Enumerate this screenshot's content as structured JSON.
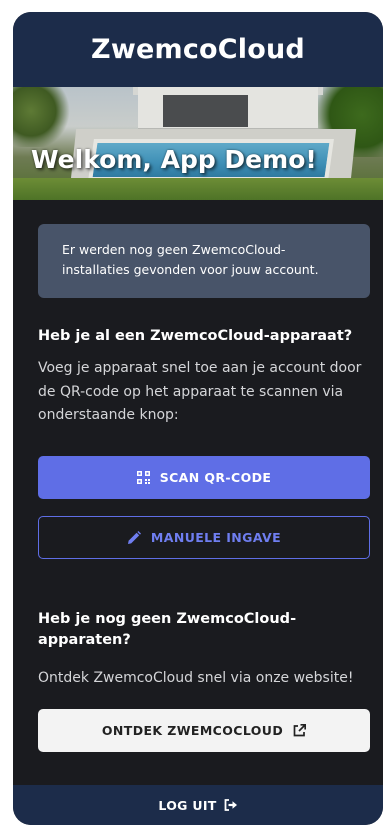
{
  "app": {
    "title": "ZwemcoCloud"
  },
  "hero": {
    "welcome": "Welkom, App Demo!"
  },
  "notice": {
    "text": "Er werden nog geen ZwemcoCloud-installaties gevonden voor jouw account."
  },
  "device_section": {
    "title": "Heb je al een ZwemcoCloud-apparaat?",
    "text": "Voeg je apparaat snel toe aan je account door de QR-code op het apparaat te scannen via onderstaande knop:",
    "scan_label": "SCAN QR-CODE",
    "manual_label": "MANUELE INGAVE"
  },
  "discover_section": {
    "title": "Heb je nog geen ZwemcoCloud-apparaten?",
    "text": "Ontdek ZwemcoCloud snel via onze website!",
    "discover_label": "ONTDEK ZWEMCOCLOUD"
  },
  "footer": {
    "logout_label": "LOG UIT"
  },
  "icons": {
    "scan": "qr-code-icon",
    "manual": "pencil-icon",
    "discover": "external-link-icon",
    "logout": "logout-icon"
  },
  "colors": {
    "header_bg": "#1c2c4a",
    "page_bg": "#1a1b1f",
    "notice_bg": "#485469",
    "primary": "#5f6ee6",
    "light_button": "#f3f3f3"
  }
}
